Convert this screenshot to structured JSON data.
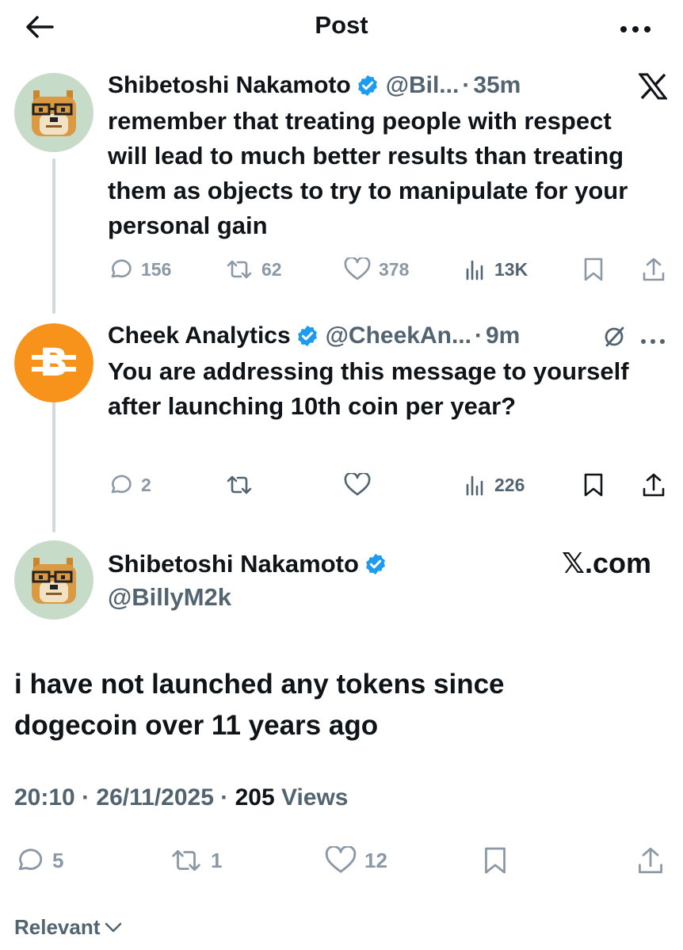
{
  "header": {
    "title": "Post"
  },
  "tweets": [
    {
      "name": "Shibetoshi Nakamoto",
      "handle": "@Bil...",
      "dot": "·",
      "time": "35m",
      "text": "remember that treating people with respect will lead to much better results than treating them as objects to try to manipulate for your personal gain",
      "replies": "156",
      "reposts": "62",
      "likes": "378",
      "views": "13K"
    },
    {
      "name": "Cheek Analytics",
      "handle": "@CheekAn...",
      "dot": "·",
      "time": "9m",
      "text": "You are addressing this message to yourself after launching 10th coin per year?",
      "replies": "2",
      "reposts": "",
      "likes": "",
      "views": "226"
    }
  ],
  "main_post": {
    "name": "Shibetoshi Nakamoto",
    "handle": "@BillyM2k",
    "source": "𝕏.com",
    "text": "i have not launched any tokens since dogecoin over 11 years ago",
    "time": "20:10",
    "sep1": " · ",
    "date": "26/11/2025",
    "sep2": " · ",
    "views_count": "205",
    "views_label": " Views",
    "replies": "5",
    "reposts": "1",
    "likes": "12"
  },
  "sort": {
    "label": "Relevant"
  },
  "colors": {
    "verified": "#1d9bf0",
    "muted": "#536471",
    "faint": "#8b98a5",
    "text": "#0f1419",
    "thread_line": "#cfd9de",
    "orange": "#f7931a",
    "avatar_bg": "#c7dcc8"
  },
  "icons": [
    "back-arrow-icon",
    "more-icon",
    "verified-icon",
    "x-logo-icon",
    "reply-icon",
    "repost-icon",
    "like-icon",
    "views-icon",
    "bookmark-icon",
    "share-icon",
    "grok-icon",
    "chevron-down-icon",
    "bitcoin-icon"
  ]
}
